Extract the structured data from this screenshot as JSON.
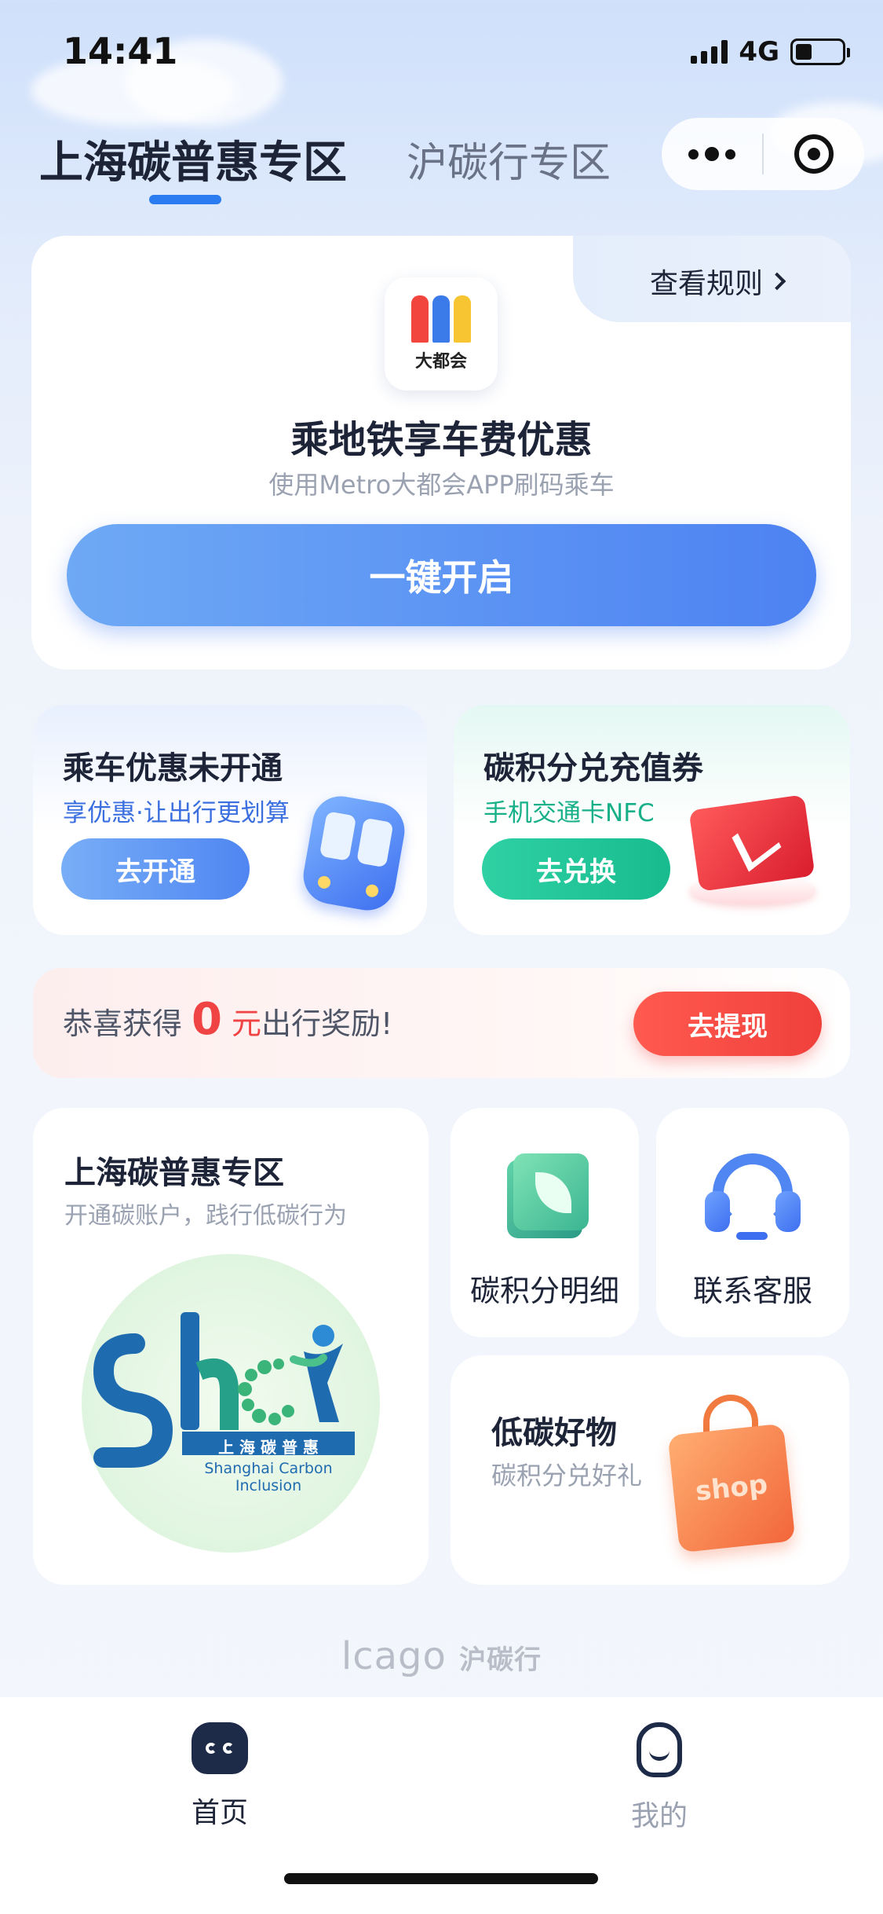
{
  "status_bar": {
    "time": "14:41",
    "network": "4G"
  },
  "header": {
    "tabs": [
      {
        "label": "上海碳普惠专区",
        "active": true
      },
      {
        "label": "沪碳行专区",
        "active": false
      }
    ]
  },
  "metro_card": {
    "rule_link": "查看规则",
    "app_logo_text": "大都会",
    "title": "乘地铁享车费优惠",
    "subtitle": "使用Metro大都会APP刷码乘车",
    "button": "一键开启"
  },
  "promo_cards": [
    {
      "title": "乘车优惠未开通",
      "subtitle": "享优惠·让出行更划算",
      "button": "去开通",
      "icon": "metro-train-icon"
    },
    {
      "title": "碳积分兑充值券",
      "subtitle": "手机交通卡NFC",
      "button": "去兑换",
      "icon": "transit-card-icon"
    }
  ],
  "reward": {
    "prefix": "恭喜获得",
    "amount": "0",
    "unit": "元",
    "suffix": "出行奖励!",
    "button": "去提现"
  },
  "grid": {
    "carbon_zone": {
      "title": "上海碳普惠专区",
      "subtitle": "开通碳账户，践行低碳行为",
      "logo_text": "上 海 碳 普 惠",
      "logo_caption": "Shanghai Carbon Inclusion"
    },
    "points_detail": {
      "label": "碳积分明细",
      "icon": "green-notebook-icon"
    },
    "customer_service": {
      "label": "联系客服",
      "icon": "headset-icon"
    },
    "low_carbon_shop": {
      "title": "低碳好物",
      "subtitle": "碳积分兑好礼",
      "bag_text": "shop",
      "icon": "shopping-bag-icon"
    }
  },
  "footer_brand": {
    "logo": "lcago",
    "name": "沪碳行"
  },
  "tabbar": [
    {
      "label": "首页",
      "active": true,
      "icon": "home-mascot-icon"
    },
    {
      "label": "我的",
      "active": false,
      "icon": "profile-icon"
    }
  ],
  "colors": {
    "accent_blue": "#4d82f2",
    "accent_green": "#17bb8e",
    "accent_red": "#f04343",
    "text_dark": "#1e2438",
    "text_muted": "#9aa1b1"
  }
}
